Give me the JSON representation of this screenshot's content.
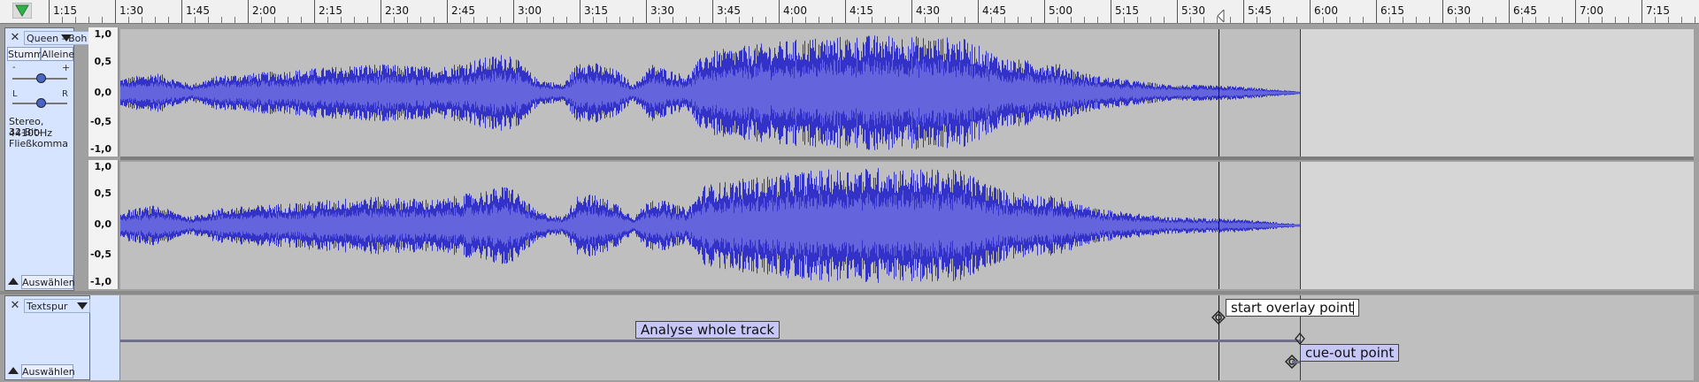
{
  "ruler": {
    "ticks": [
      "1:15",
      "1:30",
      "1:45",
      "2:00",
      "2:15",
      "2:30",
      "2:45",
      "3:00",
      "3:15",
      "3:30",
      "3:45",
      "4:00",
      "4:15",
      "4:30",
      "4:45",
      "5:00",
      "5:15",
      "5:30",
      "5:45",
      "6:00",
      "6:15",
      "6:30",
      "6:45",
      "7:00",
      "7:15"
    ]
  },
  "audio_track": {
    "name": "Queen - Boh",
    "mute_label": "Stumm",
    "solo_label": "Alleine",
    "gain_minus": "-",
    "gain_plus": "+",
    "pan_left": "L",
    "pan_right": "R",
    "format": "Stereo, 44100Hz",
    "bit_depth": "32-Bit-Fließkomma",
    "select_label": "Auswählen",
    "scale_labels": [
      "1,0",
      "0,5",
      "0,0",
      "-0,5",
      "-1,0"
    ],
    "gain_level": 0.5,
    "pan_level": 0.5
  },
  "label_track": {
    "name": "Textspur",
    "select_label": "Auswählen",
    "labels": {
      "analyse": "Analyse whole track",
      "start_overlay": "start overlay point",
      "cue_out": "cue-out point"
    }
  },
  "colors": {
    "waveform_peak": "#3232c8",
    "waveform_rms": "#6464dc",
    "track_panel": "#d6e4ff",
    "label_fill": "#c6c6f7"
  }
}
